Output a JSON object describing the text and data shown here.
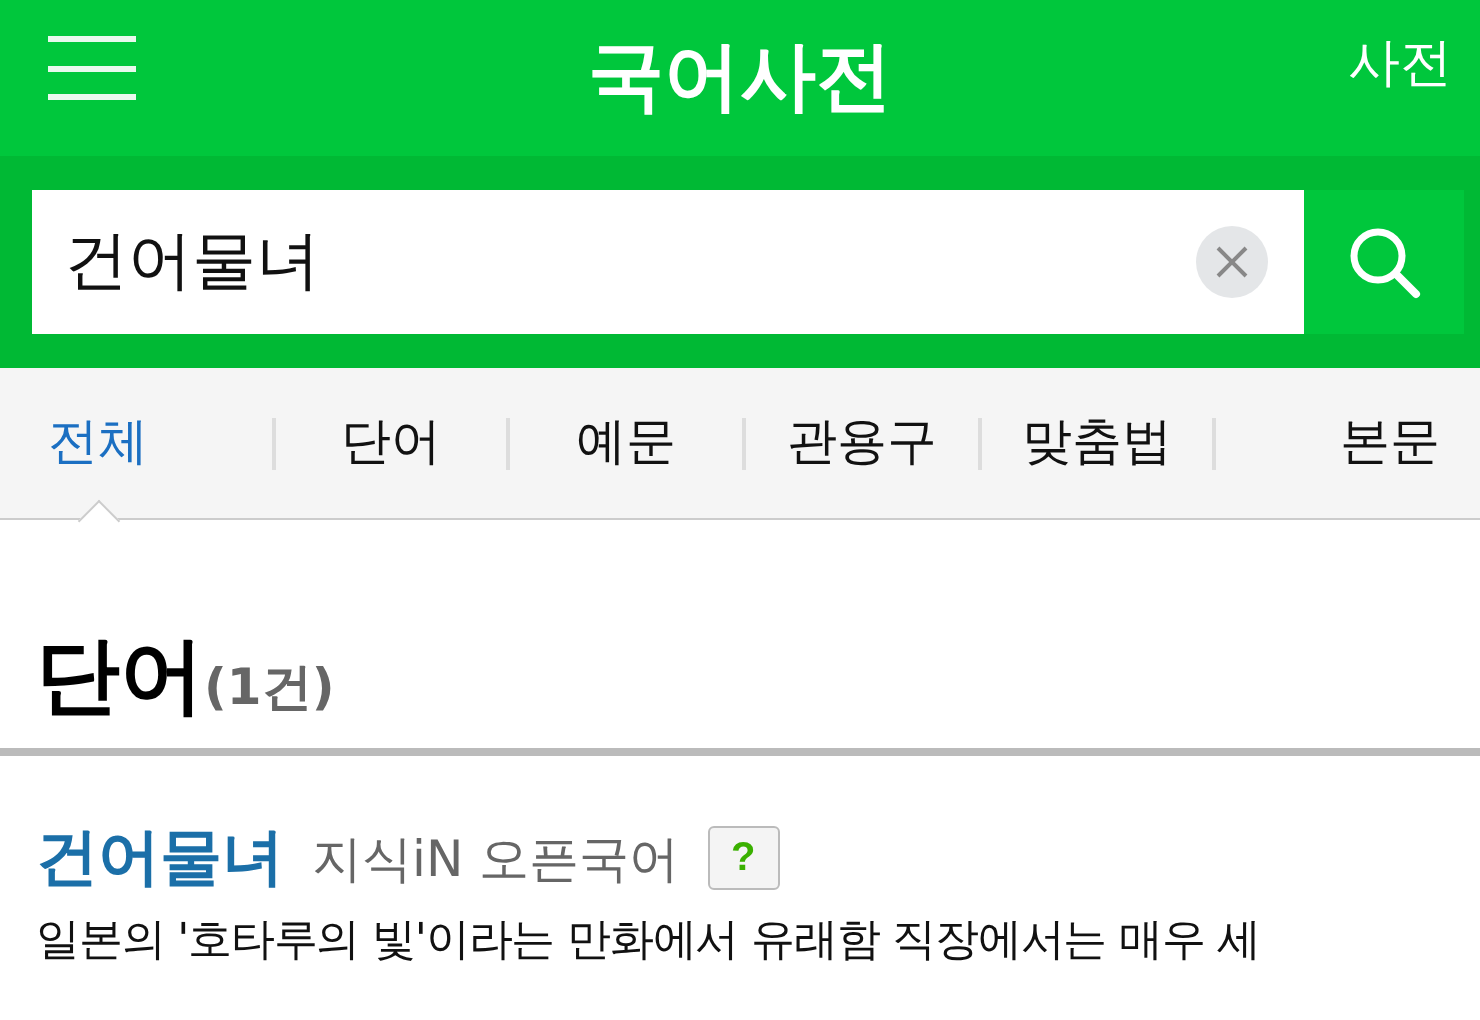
{
  "header": {
    "title": "국어사전",
    "right_link": "사전"
  },
  "search": {
    "value": "건어물녀"
  },
  "tabs": [
    {
      "label": "전체",
      "selected": true
    },
    {
      "label": "단어",
      "selected": false
    },
    {
      "label": "예문",
      "selected": false
    },
    {
      "label": "관용구",
      "selected": false
    },
    {
      "label": "맞춤법",
      "selected": false
    },
    {
      "label": "본문",
      "selected": false
    }
  ],
  "section": {
    "title": "단어",
    "count": "(1건)"
  },
  "entries": [
    {
      "word": "건어물녀",
      "source": "지식iN 오픈국어",
      "badge": "?",
      "definition": "일본의 '호타루의 빛'이라는 만화에서 유래함 직장에서는 매우 세"
    }
  ]
}
